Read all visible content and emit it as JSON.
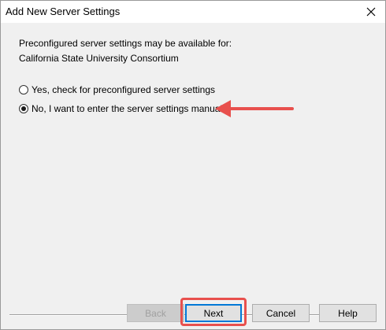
{
  "window": {
    "title": "Add New Server Settings",
    "close_icon": "close-icon"
  },
  "body": {
    "description_line1": "Preconfigured server settings may be available for:",
    "description_line2": "California State University Consortium"
  },
  "options": [
    {
      "label": "Yes, check for preconfigured server settings",
      "selected": false
    },
    {
      "label": "No, I want to enter the server settings manually",
      "selected": true
    }
  ],
  "buttons": {
    "back": "Back",
    "next": "Next",
    "cancel": "Cancel",
    "help": "Help"
  },
  "annotations": {
    "arrow_color": "#e8504d",
    "highlight_color": "#e8504d"
  }
}
